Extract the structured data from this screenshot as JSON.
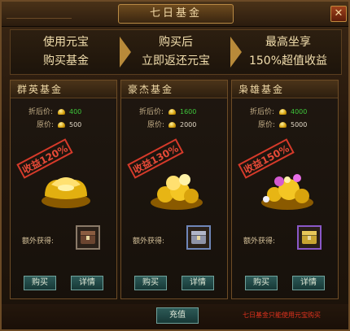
{
  "window": {
    "title": "七日基金",
    "close_icon": "close-icon"
  },
  "banner": {
    "col1": [
      "使用元宝",
      "购买基金"
    ],
    "col2": [
      "购买后",
      "立即返还元宝"
    ],
    "col3": [
      "最高坐享",
      "150%超值收益"
    ]
  },
  "labels": {
    "after_discount": "折后价:",
    "original": "原价:",
    "extra": "额外获得:",
    "buy": "购买",
    "details": "详情"
  },
  "funds": [
    {
      "name": "群英基金",
      "price_after": "400",
      "price_original": "500",
      "stamp": "收益120%",
      "chest_color": "#6b4530"
    },
    {
      "name": "豪杰基金",
      "price_after": "1600",
      "price_original": "2000",
      "stamp": "收益130%",
      "chest_color": "#8e93a8"
    },
    {
      "name": "枭雄基金",
      "price_after": "4000",
      "price_original": "5000",
      "stamp": "收益150%",
      "chest_color": "#c9a532"
    }
  ],
  "footer": {
    "recharge": "充值",
    "note": "七日基金只能使用元宝购买"
  },
  "colors": {
    "accent_gold": "#f0d9a6",
    "price_green": "#3ec63a",
    "note_red": "#e0321e",
    "stamp_red": "#d63a2a"
  }
}
